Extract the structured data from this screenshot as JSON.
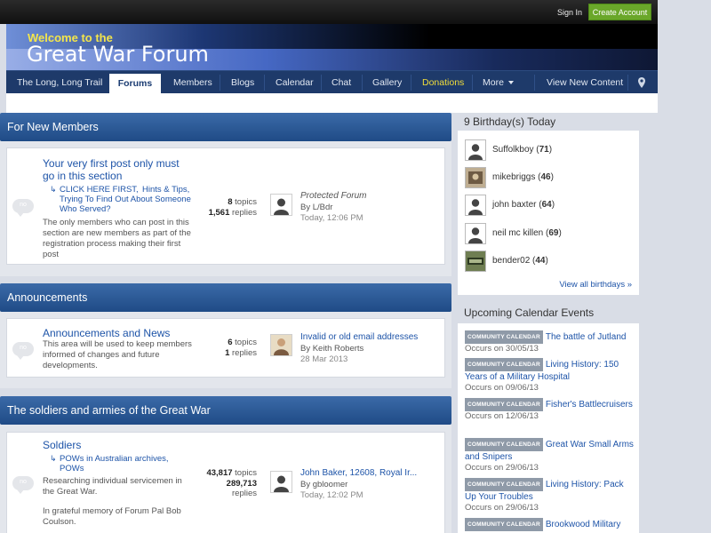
{
  "userbar": {
    "sign_in": "Sign In",
    "create_account": "Create Account"
  },
  "banner": {
    "welcome": "Welcome to the",
    "title": "Great War Forum"
  },
  "nav": {
    "items": [
      "The Long, Long Trail",
      "Forums",
      "Members",
      "Blogs",
      "Calendar",
      "Chat",
      "Gallery",
      "Donations",
      "More",
      "View New Content"
    ],
    "active": "Forums"
  },
  "categories": [
    {
      "title": "For New Members",
      "forums": [
        {
          "bubble": "no",
          "title": "Your very first post only must go in this section",
          "subforums": [
            "CLICK HERE FIRST,",
            "Hints & Tips, Trying To Find Out About Someone Who Served?"
          ],
          "description": "The only members who can post in this section are new members as part of the registration process making their first post",
          "topics": "8",
          "topics_label": "topics",
          "replies": "1,561",
          "replies_label": "replies",
          "last_title": "Protected Forum",
          "last_by": "By L/Bdr",
          "last_date": "Today, 12:06 PM"
        }
      ]
    },
    {
      "title": "Announcements",
      "forums": [
        {
          "bubble": "no",
          "title": "Announcements and News",
          "description": "This area will be used to keep members informed of changes and future developments.",
          "topics": "6",
          "topics_label": "topics",
          "replies": "1",
          "replies_label": "replies",
          "last_title": "Invalid or old email addresses",
          "last_by": "By Keith Roberts",
          "last_date": "28 Mar 2013"
        }
      ]
    },
    {
      "title": "The soldiers and armies of the Great War",
      "forums": [
        {
          "bubble": "no",
          "title": "Soldiers",
          "subforums": [
            "POWs in Australian archives,",
            "POWs"
          ],
          "description": "Researching individual servicemen in the Great War.",
          "description2": "In grateful memory of Forum Pal Bob Coulson.",
          "topics": "43,817",
          "topics_label": "topics",
          "replies": "289,713",
          "replies_label": "replies",
          "last_title": "John Baker, 12608, Royal Ir...",
          "last_by": "By gbloomer",
          "last_date": "Today, 12:02 PM"
        }
      ]
    }
  ],
  "birthdays": {
    "title": "9 Birthday(s) Today",
    "people": [
      {
        "name": "Suffolkboy",
        "age": "71"
      },
      {
        "name": "mikebriggs",
        "age": "46"
      },
      {
        "name": "john baxter",
        "age": "64"
      },
      {
        "name": "neil mc killen",
        "age": "69"
      },
      {
        "name": "bender02",
        "age": "44"
      }
    ],
    "view_all": "View all birthdays »"
  },
  "calendar": {
    "title": "Upcoming Calendar Events",
    "badge": "COMMUNITY CALENDAR",
    "events": [
      {
        "title": "The battle of Jutland",
        "date": "Occurs on 30/05/13"
      },
      {
        "title": "Living History: 150 Years of a Military Hospital",
        "date": "Occurs on 09/06/13"
      },
      {
        "title": "Fisher's Battlecruisers",
        "date": "Occurs on 12/06/13"
      },
      {
        "title": "Great War Small Arms and Snipers",
        "date": "Occurs on 29/06/13"
      },
      {
        "title": "Living History: Pack Up Your Troubles",
        "date": "Occurs on 29/06/13"
      },
      {
        "title": "Brookwood Military Cemetery Open Day",
        "date": ""
      }
    ]
  },
  "colors": {
    "nav_bg": "#1e3a6a",
    "category_header": "#2a5896",
    "link": "#1e54a8",
    "accent_green": "#6aa72a",
    "donations": "#f2de3a"
  }
}
